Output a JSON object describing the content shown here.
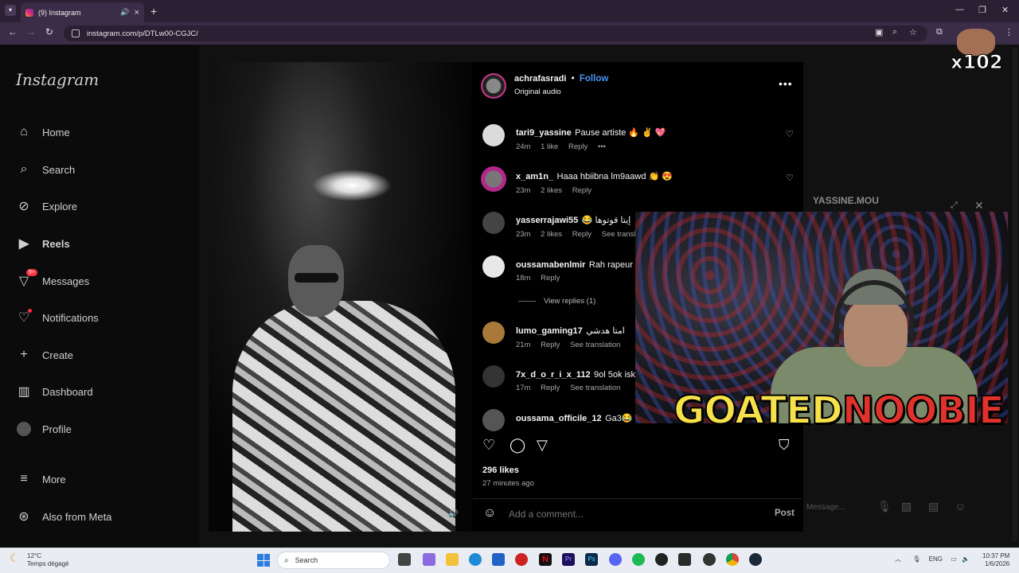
{
  "browser": {
    "tab_title": "(9) Instagram",
    "url": "instagram.com/p/DTLw00-CGJC/"
  },
  "sidebar": {
    "logo": "Instagram",
    "items": [
      {
        "label": "Home"
      },
      {
        "label": "Search"
      },
      {
        "label": "Explore"
      },
      {
        "label": "Reels"
      },
      {
        "label": "Messages",
        "badge": "9+"
      },
      {
        "label": "Notifications"
      },
      {
        "label": "Create"
      },
      {
        "label": "Dashboard"
      },
      {
        "label": "Profile"
      },
      {
        "label": "More"
      },
      {
        "label": "Also from Meta"
      }
    ]
  },
  "post": {
    "author": "achrafasradi",
    "follow": "Follow",
    "separator": "•",
    "audio": "Original audio",
    "likes": "296 likes",
    "time_ago": "27 minutes ago",
    "add_comment_placeholder": "Add a comment...",
    "post_button": "Post"
  },
  "comments": [
    {
      "user": "tari9_yassine",
      "text": "Pause artiste 🔥 ✌ 💖",
      "time": "24m",
      "likes": "1 like",
      "reply": "Reply",
      "more": "•••"
    },
    {
      "user": "x_am1n_",
      "text": "Haaa hbiibna lm9aawd 👏 😍",
      "time": "23m",
      "likes": "2 likes",
      "reply": "Reply"
    },
    {
      "user": "yasserrajawi55",
      "text": "😂 إيتا قوتوها",
      "time": "23m",
      "likes": "2 likes",
      "reply": "Reply",
      "translate": "See transla"
    },
    {
      "user": "oussamabenlmir",
      "text": "Rah rapeur",
      "time": "18m",
      "reply": "Reply",
      "view_replies": "View replies (1)"
    },
    {
      "user": "lumo_gaming17",
      "text": "امتا هدشي",
      "time": "21m",
      "reply": "Reply",
      "translate": "See translation"
    },
    {
      "user": "7x_d_o_r_i_x_112",
      "text": "9ol 5ok isk",
      "time": "17m",
      "reply": "Reply",
      "translate": "See translation"
    },
    {
      "user": "oussama_officile_12",
      "text": "Ga3😂"
    }
  ],
  "overlay": {
    "chat_title": "YASSINE.MOU",
    "banner_left": "GOATED",
    "banner_right": "NOOBIE",
    "counter": "x102",
    "message_placeholder": "Message..."
  },
  "taskbar": {
    "temp": "12°C",
    "weather": "Temps dégagé",
    "search": "Search",
    "lang": "ENG",
    "time": "10:37 PM",
    "date": "1/6/2026"
  },
  "colors": {
    "follow_blue": "#4a95f6",
    "banner_yellow": "#f7e14a",
    "banner_red": "#e0322b"
  }
}
